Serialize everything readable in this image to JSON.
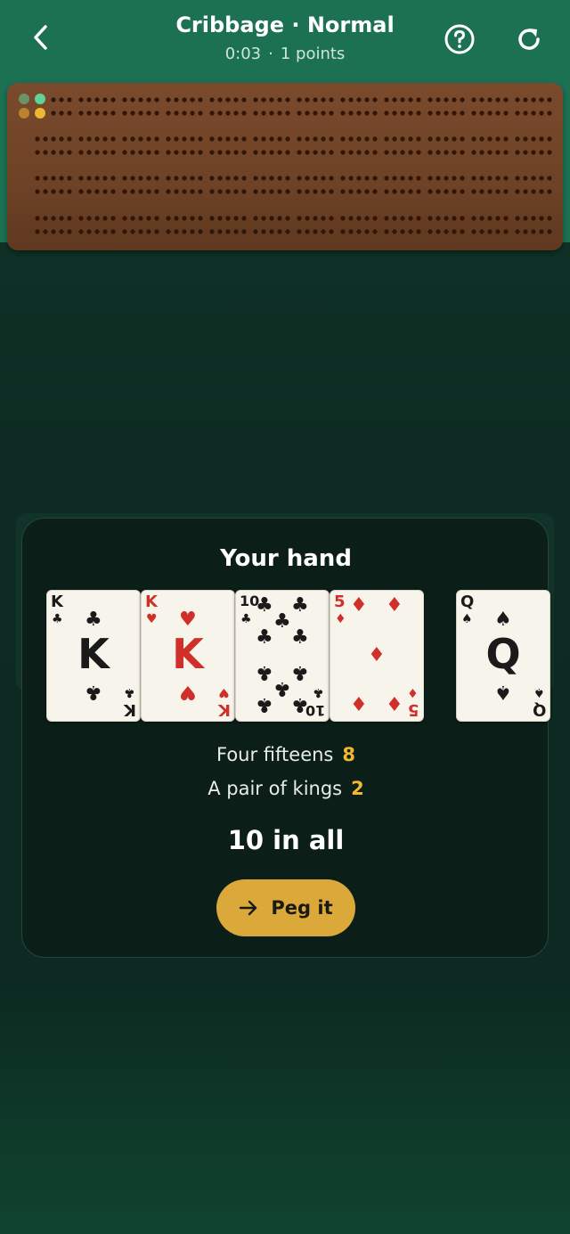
{
  "header": {
    "title": "Cribbage · Normal",
    "timer": "0:03",
    "separator": "·",
    "points": "1 points",
    "back_icon": "chevron-left-icon",
    "help_icon": "help-circle-icon",
    "restart_icon": "restart-icon"
  },
  "colors": {
    "header_bg": "#1b7152",
    "board_wood": "#6e4226",
    "peg_green": "#5fd39a",
    "peg_yellow": "#f0b732",
    "accent_gold": "#dba93a",
    "card_red": "#d0302a"
  },
  "panel": {
    "title": "Your hand",
    "cards": [
      {
        "rank": "K",
        "suit": "♣",
        "color": "black"
      },
      {
        "rank": "K",
        "suit": "♥",
        "color": "red"
      },
      {
        "rank": "10",
        "suit": "♣",
        "color": "black"
      },
      {
        "rank": "5",
        "suit": "♦",
        "color": "red"
      }
    ],
    "starter_card": {
      "rank": "Q",
      "suit": "♠",
      "color": "black"
    },
    "scores": [
      {
        "label": "Four fifteens",
        "points": "8"
      },
      {
        "label": "A pair of kings",
        "points": "2"
      }
    ],
    "total": "10 in all",
    "button_label": "Peg it",
    "button_icon": "arrow-right-icon"
  }
}
